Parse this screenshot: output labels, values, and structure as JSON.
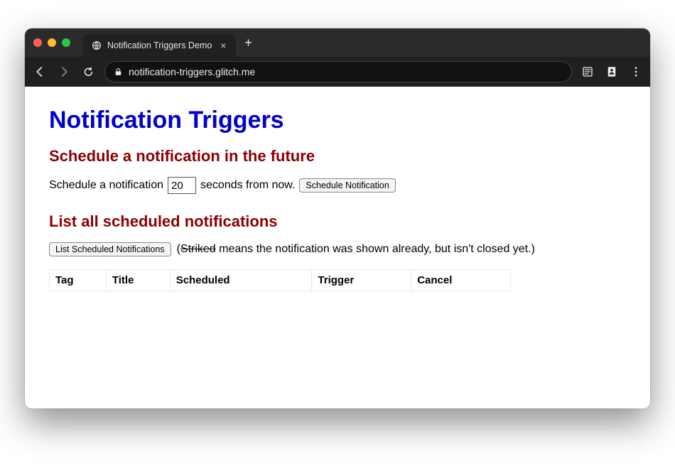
{
  "browser": {
    "tab_title": "Notification Triggers Demo",
    "url": "notification-triggers.glitch.me"
  },
  "page": {
    "h1": "Notification Triggers",
    "schedule": {
      "heading": "Schedule a notification in the future",
      "prefix": "Schedule a notification",
      "seconds_value": "20",
      "suffix": "seconds from now.",
      "button": "Schedule Notification"
    },
    "list": {
      "heading": "List all scheduled notifications",
      "button": "List Scheduled Notifications",
      "note_open": "(",
      "note_striked": "Striked",
      "note_rest": " means the notification was shown already, but isn't closed yet.)",
      "columns": [
        "Tag",
        "Title",
        "Scheduled",
        "Trigger",
        "Cancel"
      ],
      "rows": []
    }
  }
}
